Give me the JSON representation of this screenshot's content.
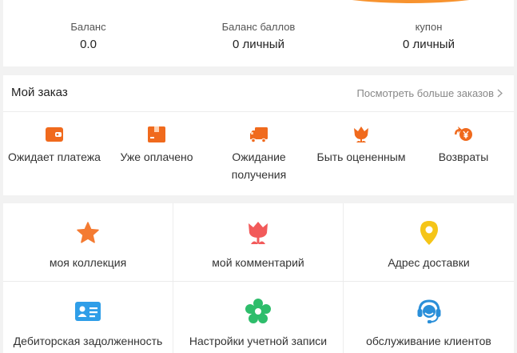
{
  "balance": {
    "items": [
      {
        "label": "Баланс",
        "value": "0.0"
      },
      {
        "label": "Баланс баллов",
        "value": "0 личный"
      },
      {
        "label": "купон",
        "value": "0 личный"
      }
    ]
  },
  "orders": {
    "title": "Мой заказ",
    "more_label": "Посмотреть больше заказов",
    "items": [
      {
        "label": "Ожидает платежа",
        "icon": "wallet-icon"
      },
      {
        "label": "Уже оплачено",
        "icon": "package-icon"
      },
      {
        "label": "Ожидание получения",
        "icon": "truck-icon"
      },
      {
        "label": "Быть оцененным",
        "icon": "flower-icon"
      },
      {
        "label": "Возвраты",
        "icon": "yen-coin-icon"
      }
    ]
  },
  "services": {
    "items": [
      {
        "label": "моя коллекция",
        "icon": "star-icon"
      },
      {
        "label": "мой комментарий",
        "icon": "tulip-icon"
      },
      {
        "label": "Адрес доставки",
        "icon": "location-pin-icon"
      },
      {
        "label": "Дебиторская задолженность",
        "icon": "id-card-icon"
      },
      {
        "label": "Настройки учетной записи",
        "icon": "settings-flower-icon"
      },
      {
        "label": "обслуживание клиентов",
        "icon": "headset-icon"
      }
    ]
  },
  "colors": {
    "accent": "#f7932f",
    "orange": "#f06a1d",
    "star": "#f47b32",
    "tulip": "#f25a5a",
    "pin": "#f5c518",
    "card": "#2f9ee8",
    "gear": "#2ebd6b",
    "headset": "#2a8fd9"
  }
}
